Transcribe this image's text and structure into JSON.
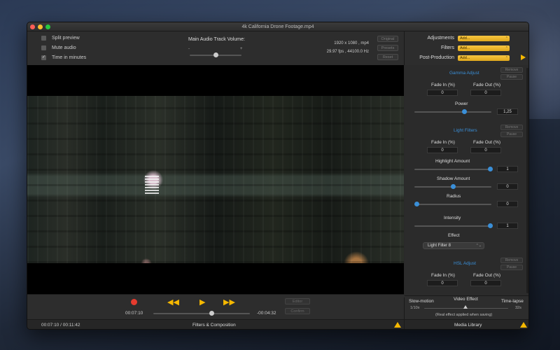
{
  "window": {
    "title": "4k California Drone Footage.mp4"
  },
  "options": {
    "split_preview": "Split preview",
    "mute_audio": "Mute audio",
    "time_in_minutes": "Time in minutes",
    "time_in_minutes_check": "✓"
  },
  "audio": {
    "label": "Main Audio Track Volume:",
    "minus": "-",
    "plus": "+",
    "volume": 0.5
  },
  "media_info": {
    "resolution": "1920 x 1080 , mp4",
    "fps_audio": "29.97 fps , 44100.0 Hz"
  },
  "side_buttons": {
    "original": "Original",
    "presets": "Presets",
    "reset": "Reset"
  },
  "right_menu": {
    "adjustments_label": "Adjustments",
    "filters_label": "Filters",
    "post_label": "Post-Production",
    "adjustments_value": "Add...",
    "filters_value": "Add...",
    "post_value": "Add..."
  },
  "effects": {
    "remove": "Remove",
    "pause": "Pause",
    "fade_in": "Fade In (%)",
    "fade_out": "Fade Out (%)",
    "gamma": {
      "title": "Gamma Adjust",
      "fade_in": "0",
      "fade_out": "0",
      "power_label": "Power",
      "power": "1,25"
    },
    "light": {
      "title": "Light Filters",
      "fade_in": "0",
      "fade_out": "0",
      "highlight_label": "Highlight Amount",
      "highlight": "1",
      "shadow_label": "Shadow Amount",
      "shadow": "0",
      "radius_label": "Radius",
      "radius": "0",
      "intensity_label": "Intensity",
      "intensity": "1",
      "effect_label": "Effect",
      "effect_value": "Light Filter 8"
    },
    "hsl": {
      "title": "HSL Adjust",
      "fade_in": "0",
      "fade_out": "0"
    }
  },
  "playback": {
    "elapsed": "00:07:10",
    "remaining": "-00:04:32",
    "position": 0.6,
    "rewind": "◀◀",
    "play": "▶",
    "forward": "▶▶"
  },
  "editor_buttons": {
    "editor": "Editor",
    "confirm": "Confirm"
  },
  "video_effect": {
    "slow": "Slow-motion",
    "title": "Video Effect",
    "timelapse": "Time-lapse",
    "min": "1/10x",
    "max": "32s",
    "note": "(Real effect applied when saving)",
    "value": 0.5
  },
  "status": {
    "times": "00:07:10 / 00:11:42",
    "center": "Filters & Composition",
    "right": "Media Library"
  },
  "colors": {
    "accent": "#f5b800",
    "blue": "#3a8fd8",
    "record": "#e53b2e"
  }
}
